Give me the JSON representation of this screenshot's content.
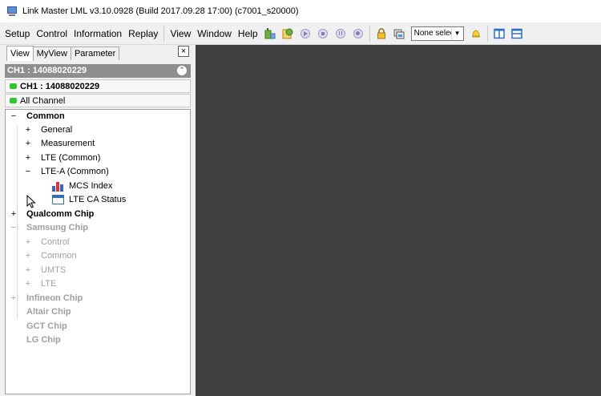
{
  "window": {
    "title": "Link Master LML v3.10.0928 (Build 2017.09.28 17:00) (c7001_s20000)"
  },
  "menu": [
    "Setup",
    "Control",
    "Information",
    "Replay",
    "View",
    "Window",
    "Help"
  ],
  "toolbar": {
    "device_select_value": "None selec",
    "icons": [
      "modem-icon",
      "log-icon",
      "play-icon",
      "stop-icon",
      "pause-icon",
      "record-icon",
      "lock-icon",
      "capture-icon",
      "bell-icon",
      "tile-vertical-icon",
      "tile-horizontal-icon"
    ]
  },
  "left_panel": {
    "tabs": [
      "View",
      "MyView",
      "Parameter"
    ],
    "close_label": "×",
    "channel_header": "CH1 : 14088020229",
    "channel_row": "CH1 : 14088020229",
    "all_channel": "All Channel",
    "status_color": "#2fc82f"
  },
  "tree": {
    "common": {
      "exp": "−",
      "label": "Common"
    },
    "general": {
      "exp": "+",
      "label": "General"
    },
    "measurement": {
      "exp": "+",
      "label": "Measurement"
    },
    "lte_common": {
      "exp": "+",
      "label": "LTE (Common)"
    },
    "ltea_common": {
      "exp": "−",
      "label": "LTE-A (Common)"
    },
    "mcs_index": {
      "label": "MCS Index",
      "icon": "bar-chart-icon"
    },
    "lte_ca_status": {
      "label": "LTE CA Status",
      "icon": "window-icon"
    },
    "qualcomm": {
      "exp": "+",
      "label": "Qualcomm Chip"
    },
    "samsung": {
      "exp": "−",
      "label": "Samsung Chip"
    },
    "s_control": {
      "exp": "+",
      "label": "Control"
    },
    "s_common": {
      "exp": "+",
      "label": "Common"
    },
    "s_umts": {
      "exp": "+",
      "label": "UMTS"
    },
    "s_lte": {
      "exp": "+",
      "label": "LTE"
    },
    "infineon": {
      "exp": "+",
      "label": "Infineon Chip"
    },
    "altair": {
      "label": "Altair Chip"
    },
    "gct": {
      "label": "GCT Chip"
    },
    "lg": {
      "label": "LG Chip"
    }
  },
  "colors": {
    "workspace_bg": "#414141",
    "accent_blue": "#2f6fc0"
  }
}
